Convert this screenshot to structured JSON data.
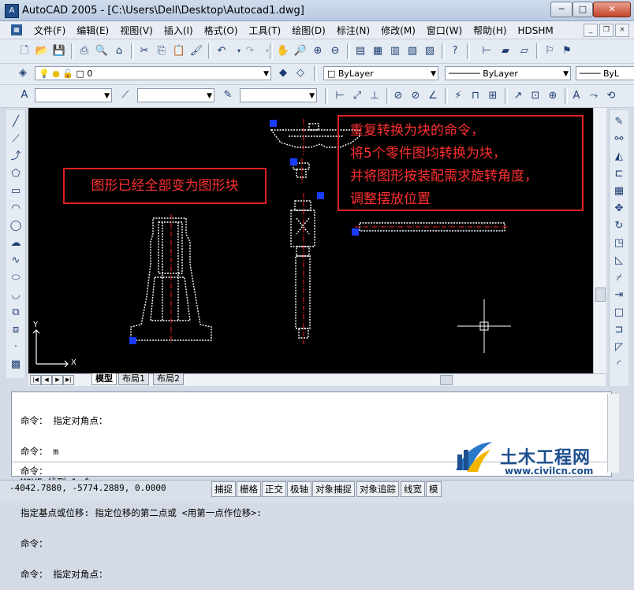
{
  "window": {
    "title": "AutoCAD 2005 - [C:\\Users\\Dell\\Desktop\\Autocad1.dwg]",
    "minimize": "─",
    "maximize": "□",
    "close": "✕"
  },
  "menu": {
    "items": [
      "文件(F)",
      "编辑(E)",
      "视图(V)",
      "插入(I)",
      "格式(O)",
      "工具(T)",
      "绘图(D)",
      "标注(N)",
      "修改(M)",
      "窗口(W)",
      "帮助(H)",
      "HDSHM"
    ],
    "mdi_min": "_",
    "mdi_restore": "❐",
    "mdi_close": "×"
  },
  "layers_toolbar": {
    "layer_name": "0",
    "color": "ByLayer",
    "linetype": "ByLayer",
    "lineweight": "ByL"
  },
  "styles_toolbar": {
    "text_style": "",
    "dim_style": "",
    "plot_style": ""
  },
  "tabs": [
    "模型",
    "布局1",
    "布局2"
  ],
  "ucs": {
    "x_label": "X",
    "y_label": "Y"
  },
  "command_window": {
    "lines": [
      "命令： 指定对角点：",
      "命令： m",
      "MOVE 找到 1 个",
      "指定基点或位移: 指定位移的第二点或 <用第一点作位移>:",
      "命令：",
      "命令： 指定对角点："
    ],
    "prompt": "命令："
  },
  "statusbar": {
    "coords": "-4042.7880, -5774.2889, 0.0000",
    "buttons": [
      "捕捉",
      "栅格",
      "正交",
      "极轴",
      "对象捕捉",
      "对象追踪",
      "线宽",
      "模"
    ]
  },
  "annotations": {
    "left": "图形已经全部变为图形块",
    "right_lines": [
      "重复转换为块的命令，",
      "将5个零件图均转换为块，",
      "并将图形按装配需求旋转角度，",
      "调整摆放位置"
    ]
  },
  "watermark": {
    "title": "土木工程网",
    "url": "www.civilcn.com"
  },
  "colors": {
    "annotation_red": "#e02020",
    "canvas_bg": "#000000",
    "grip_blue": "#1a3cff",
    "watermark_blue": "#1d4f8f"
  }
}
